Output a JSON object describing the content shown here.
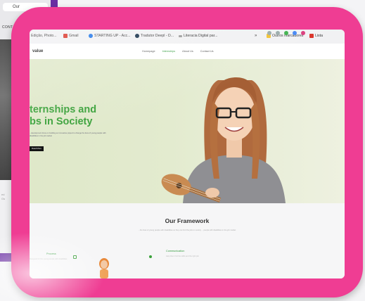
{
  "background_window": {
    "tab_label": "Our",
    "heading": "CONTA",
    "lower_text": [
      "ed",
      "Gs"
    ]
  },
  "bookmarks_bar": {
    "items": [
      {
        "label": "Edição, Photo...",
        "icon": "bookmark-icon"
      },
      {
        "label": "Gmail",
        "icon": "gmail-icon",
        "color": "#d93025"
      },
      {
        "label": "STARTING UP - Acc...",
        "icon": "globe-icon",
        "color": "#1a73e8"
      },
      {
        "label": "Tradutor Deepl - D...",
        "icon": "deepl-icon",
        "color": "#0f2b46"
      },
      {
        "label": "Literacia Digital par...",
        "icon": "link-icon",
        "color": "#7a7a7a"
      },
      {
        "label": "Outros marcadores",
        "icon": "folder-icon",
        "color": "#f2c230"
      },
      {
        "label": "Lista",
        "icon": "reading-list-icon",
        "color": "#d93025"
      }
    ]
  },
  "site": {
    "logo": "value",
    "nav": [
      "Homepage",
      "Internships",
      "About Us",
      "Contact Us"
    ],
    "active_nav_index": 1
  },
  "hero": {
    "title_line1": "ternships and",
    "title_line2": "bs in Society",
    "text": "...development focus on building an innovative project to change the lives of young people with disabilities in the job market",
    "button": "Read More",
    "accent": "#3aa13a"
  },
  "framework": {
    "title": "Our Framework",
    "subtitle": "...the lives of young people with disabilities so they can find the jobs in society ... people with disabilities in the job market",
    "columns": [
      {
        "title": "Process",
        "text": "Designed for the young people with disabilities"
      },
      {
        "title": "Communication",
        "text": "Help them find the skills and the right job"
      }
    ]
  },
  "colors": {
    "frame": "#ef3d93",
    "background_window": "#6b2fa3"
  }
}
